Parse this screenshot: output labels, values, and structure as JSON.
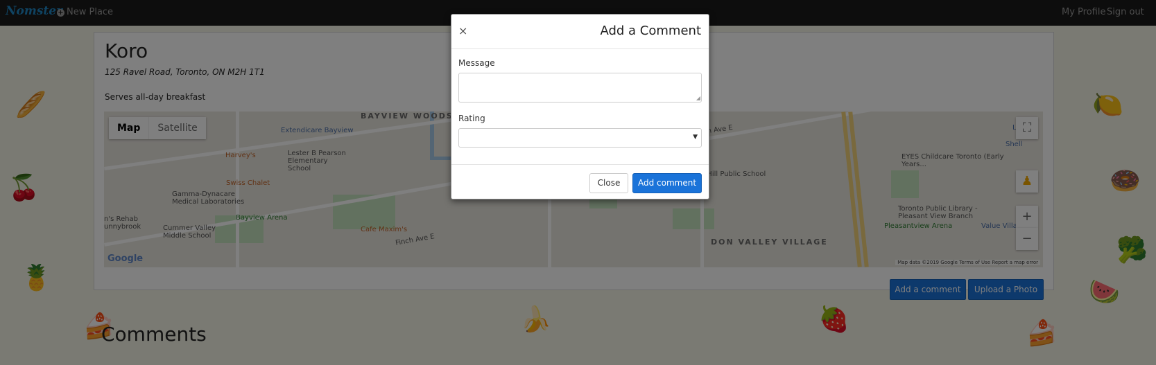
{
  "navbar": {
    "brand": "Nomster",
    "new_place": "New Place",
    "my_profile": "My Profile",
    "sign_out": "Sign out"
  },
  "place": {
    "name": "Koro",
    "address": "125 Ravel Road, Toronto, ON M2H 1T1",
    "description": "Serves all-day breakfast"
  },
  "map": {
    "type_map": "Map",
    "type_satellite": "Satellite",
    "fullscreen_icon": "⛶",
    "pegman_icon": "♟",
    "zoom_in": "+",
    "zoom_out": "−",
    "google": "Google",
    "attribution": "Map data ©2019 Google   Terms of Use   Report a map error",
    "labels": {
      "bayview_woods": "BAYVIEW WOODS - STEELES",
      "don_valley_village": "DON VALLEY VILLAGE",
      "extendicare": "Extendicare Bayview",
      "harveys": "Harvey's",
      "lester": "Lester B Pearson Elementary School",
      "swiss_chalet": "Swiss Chalet",
      "gamma": "Gamma-Dynacare Medical Laboratories",
      "cummer_valley": "Cummer Valley Middle School",
      "bayview_arena": "Bayview Arena",
      "cafe_maxims": "Cafe Maxim's",
      "rehab": "n's Rehab unnybrook",
      "finch_ave_e": "Finch Ave E",
      "eyes_childcare": "EYES Childcare Toronto (Early Years...",
      "tpl": "Toronto Public Library - Pleasant View Branch",
      "pleasantview_arena": "Pleasantview Arena",
      "value_village": "Value Village",
      "hill_public": "a Hill Public School",
      "shell": "Shell",
      "lcb": "LCB"
    }
  },
  "actions": {
    "add_comment": "Add a comment",
    "upload_photo": "Upload a Photo"
  },
  "comments": {
    "title": "Comments"
  },
  "modal": {
    "close_x": "×",
    "title": "Add a Comment",
    "message_label": "Message",
    "message_value": "",
    "rating_label": "Rating",
    "rating_value": "",
    "close_button": "Close",
    "submit_button": "Add comment"
  }
}
